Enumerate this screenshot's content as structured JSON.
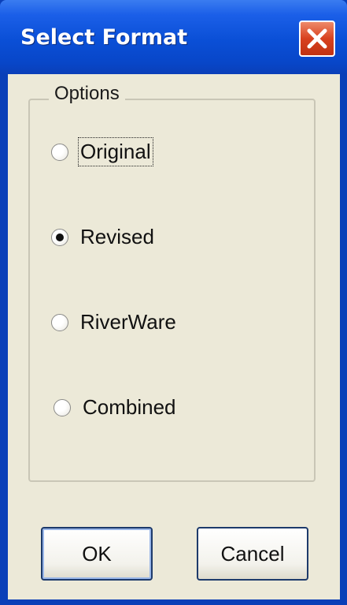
{
  "window": {
    "title": "Select Format",
    "close_icon": "close-icon"
  },
  "options_group": {
    "label": "Options",
    "options": [
      {
        "label": "Original",
        "selected": false,
        "focused": true
      },
      {
        "label": "Revised",
        "selected": true,
        "focused": false
      },
      {
        "label": "RiverWare",
        "selected": false,
        "focused": false
      },
      {
        "label": "Combined",
        "selected": false,
        "focused": false,
        "mnemonic": "b"
      }
    ]
  },
  "buttons": {
    "ok_label": "OK",
    "ok_mnemonic": "O",
    "cancel_label": "Cancel",
    "cancel_mnemonic": "c"
  },
  "colors": {
    "titlebar": "#0a4fd6",
    "client_background": "#ece9d8",
    "close_button": "#d8411f"
  }
}
